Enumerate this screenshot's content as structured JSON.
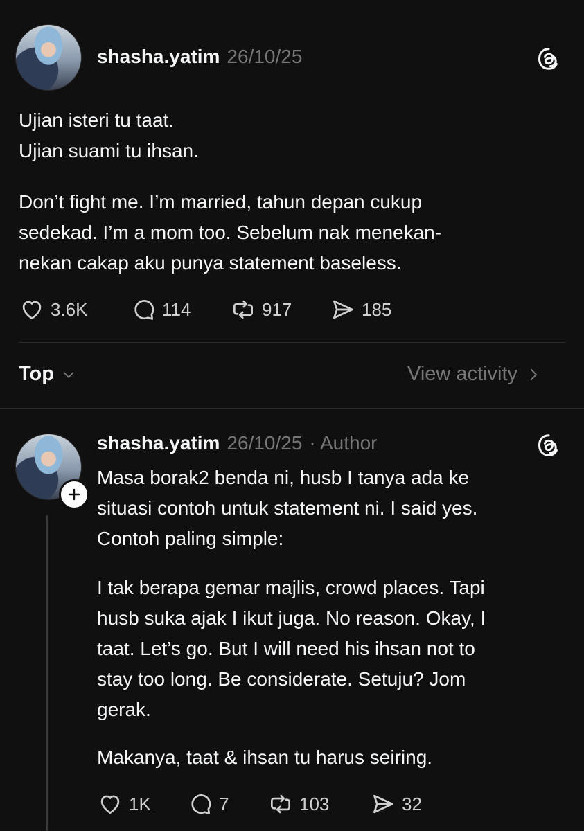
{
  "post": {
    "username": "shasha.yatim",
    "date": "26/10/25",
    "lines": [
      "Ujian isteri tu taat.",
      "Ujian suami tu ihsan."
    ],
    "para2": [
      "Don’t fight me. I’m married, tahun depan cukup",
      "sedekad. I’m a mom too. Sebelum nak menekan-",
      "nekan cakap aku punya statement baseless."
    ],
    "stats": {
      "likes": "3.6K",
      "replies": "114",
      "reposts": "917",
      "shares": "185"
    }
  },
  "sort": {
    "label": "Top",
    "view_activity": "View activity"
  },
  "reply": {
    "username": "shasha.yatim",
    "date": "26/10/25",
    "author_tag": "· Author",
    "para1": [
      "Masa borak2 benda ni, husb I tanya ada ke",
      "situasi contoh untuk statement ni. I said yes.",
      "Contoh paling simple:"
    ],
    "para2": [
      "I tak berapa gemar majlis, crowd places. Tapi",
      "husb suka ajak I ikut juga. No reason. Okay, I",
      "taat. Let’s go. But I will need his ihsan not to",
      "stay too long. Be considerate. Setuju? Jom",
      "gerak."
    ],
    "para3": [
      "Makanya, taat & ihsan tu harus seiring."
    ],
    "stats": {
      "likes": "1K",
      "replies": "7",
      "reposts": "103",
      "shares": "32"
    }
  },
  "icons": [
    "threads-logo-icon",
    "heart-icon",
    "comment-icon",
    "repost-icon",
    "share-icon",
    "chevron-down-icon",
    "chevron-right-icon",
    "follow-plus-icon"
  ]
}
